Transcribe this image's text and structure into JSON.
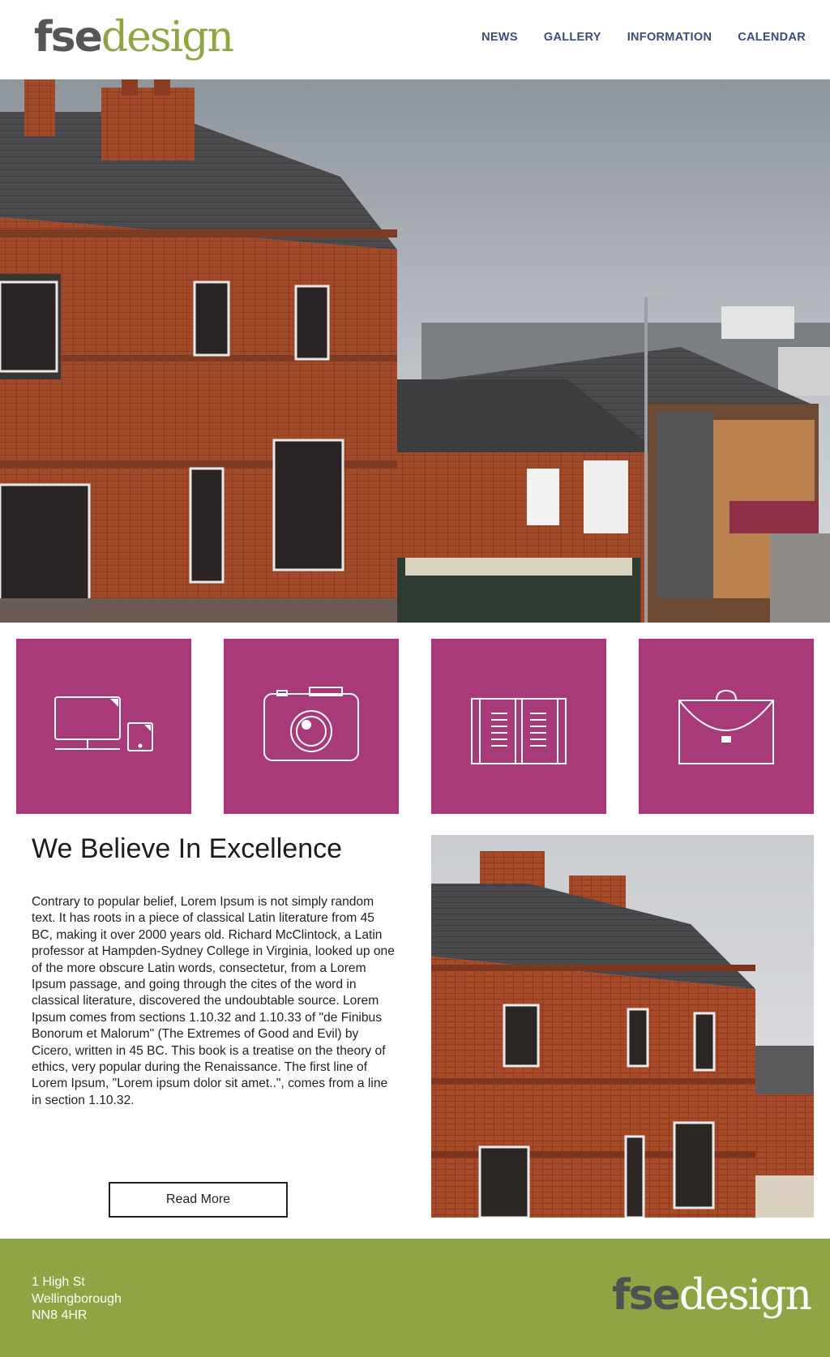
{
  "brand": {
    "logo_part1": "fse",
    "logo_part2": "design"
  },
  "nav": {
    "items": [
      {
        "label": "NEWS"
      },
      {
        "label": "GALLERY"
      },
      {
        "label": "INFORMATION"
      },
      {
        "label": "CALENDAR"
      }
    ]
  },
  "tiles": [
    {
      "icon": "devices-icon"
    },
    {
      "icon": "camera-icon"
    },
    {
      "icon": "book-icon"
    },
    {
      "icon": "briefcase-icon"
    }
  ],
  "main": {
    "headline": "We Believe In Excellence",
    "body": "Contrary to popular belief, Lorem Ipsum is not simply random text. It has roots in a piece of classical Latin literature from 45 BC, making it over 2000 years old. Richard McClintock, a Latin professor at Hampden-Sydney College in Virginia, looked up one of the more obscure Latin words, consectetur, from a Lorem Ipsum passage, and going through the cites of the word in classical literature, discovered the undoubtable source. Lorem Ipsum comes from sections 1.10.32 and 1.10.33 of \"de Finibus Bonorum et Malorum\" (The Extremes of Good and Evil) by Cicero, written in 45 BC. This book is a treatise on the theory of ethics, very popular during the Renaissance. The first line of Lorem Ipsum, \"Lorem ipsum dolor sit amet..\", comes from a line in section 1.10.32.",
    "read_more": "Read More"
  },
  "footer": {
    "address_line1": "1 High St",
    "address_line2": "Wellingborough",
    "address_line3": "NN8 4HR"
  },
  "colors": {
    "accent_green": "#8fa544",
    "tile_magenta": "#a93a79",
    "nav_blue": "#3a4e78"
  }
}
